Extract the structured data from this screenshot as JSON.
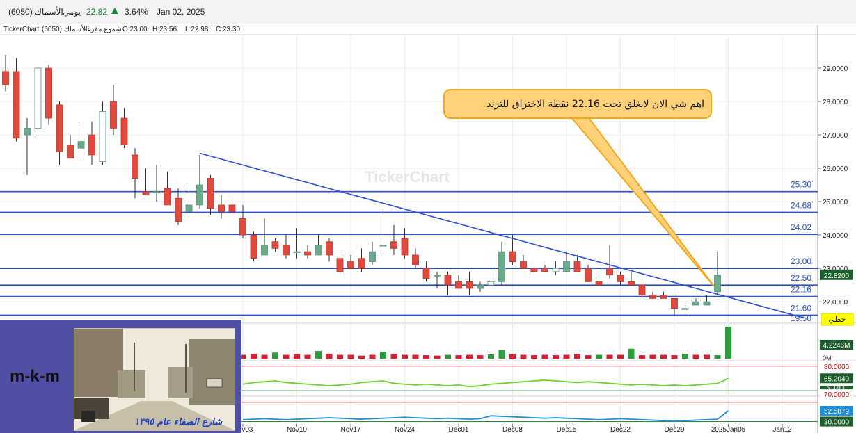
{
  "header": {
    "symbol": "الأسماك (6050)",
    "period": "يومي",
    "price": "22.82",
    "change_icon": "triangle-up-icon",
    "change_pct": "3.64%",
    "date": "Jan 02, 2025"
  },
  "ohlc_line": {
    "brand": "TickerChart",
    "symbol": "الأسماك (6050)",
    "chart_style": "شموع مفرغة",
    "open": "O:23.00",
    "high": "H:23.56",
    "low": "L:22.98",
    "close": "C:23.30"
  },
  "watermark": "TickerChart",
  "annotation_text": "اهم شي الان لايغلق تحت 22.16 نقطة الاختراق للترند",
  "line_type_label": "خطي",
  "colors": {
    "up": "#6aab8c",
    "down": "#e0493d",
    "hline": "#2b4fd6",
    "trend": "#2b4fd6",
    "callout_fill": "#ffd27a",
    "callout_border": "#f4a81f",
    "rsi": "#6fcf2c",
    "cci": "#1e8fd8",
    "panel_badge": "#1b5f2d"
  },
  "horizontal_levels": [
    {
      "value": 25.3,
      "label": "25.30"
    },
    {
      "value": 24.68,
      "label": "24.68"
    },
    {
      "value": 24.02,
      "label": "24.02"
    },
    {
      "value": 23.0,
      "label": "23.00"
    },
    {
      "value": 22.5,
      "label": "22.50"
    },
    {
      "value": 22.16,
      "label": "22.16"
    },
    {
      "value": 21.6,
      "label": "21.60"
    }
  ],
  "extra_label": {
    "value": 19.5,
    "label": "19.50"
  },
  "price_badge": "22.8200",
  "chart_data": {
    "type": "candlestick",
    "ylim": [
      21.4,
      30.0
    ],
    "y_ticks": [
      "22.0000",
      "23.0000",
      "24.0000",
      "25.0000",
      "26.0000",
      "27.0000",
      "28.0000",
      "29.0000"
    ],
    "y_tick_values": [
      22,
      23,
      24,
      25,
      26,
      27,
      28,
      29
    ],
    "x_labels": [
      "Nov03",
      "Nov10",
      "Nov17",
      "Nov24",
      "Dec01",
      "Dec08",
      "Dec15",
      "Dec22",
      "Dec29",
      "2025Jan05",
      "Jan12"
    ],
    "x_label_index": [
      22,
      27,
      32,
      37,
      42,
      47,
      52,
      57,
      62,
      67,
      72
    ],
    "candles": [
      {
        "o": 28.9,
        "h": 29.4,
        "l": 28.3,
        "c": 28.5
      },
      {
        "o": 28.9,
        "h": 29.3,
        "l": 26.8,
        "c": 26.9
      },
      {
        "o": 27.0,
        "h": 27.5,
        "l": 25.8,
        "c": 27.2
      },
      {
        "o": 27.2,
        "h": 29.0,
        "l": 26.9,
        "c": 29.0
      },
      {
        "o": 29.0,
        "h": 29.1,
        "l": 27.3,
        "c": 27.5
      },
      {
        "o": 27.9,
        "h": 28.0,
        "l": 26.1,
        "c": 26.5
      },
      {
        "o": 26.7,
        "h": 27.0,
        "l": 26.3,
        "c": 26.3
      },
      {
        "o": 26.6,
        "h": 27.3,
        "l": 26.3,
        "c": 26.8
      },
      {
        "o": 27.0,
        "h": 27.4,
        "l": 26.1,
        "c": 26.4
      },
      {
        "o": 26.2,
        "h": 28.0,
        "l": 26.1,
        "c": 27.7
      },
      {
        "o": 28.0,
        "h": 28.5,
        "l": 27.0,
        "c": 27.2
      },
      {
        "o": 27.5,
        "h": 27.8,
        "l": 26.6,
        "c": 26.7
      },
      {
        "o": 26.4,
        "h": 26.6,
        "l": 25.1,
        "c": 25.7
      },
      {
        "o": 25.3,
        "h": 26.0,
        "l": 25.2,
        "c": 25.2
      },
      {
        "o": 25.3,
        "h": 26.1,
        "l": 25.0,
        "c": 25.3
      },
      {
        "o": 25.4,
        "h": 25.9,
        "l": 25.0,
        "c": 24.9
      },
      {
        "o": 25.1,
        "h": 25.4,
        "l": 24.3,
        "c": 24.4
      },
      {
        "o": 24.7,
        "h": 25.5,
        "l": 24.6,
        "c": 24.9
      },
      {
        "o": 24.9,
        "h": 26.4,
        "l": 24.8,
        "c": 25.5
      },
      {
        "o": 25.7,
        "h": 25.8,
        "l": 24.6,
        "c": 24.8
      },
      {
        "o": 24.9,
        "h": 25.2,
        "l": 24.5,
        "c": 24.7
      },
      {
        "o": 24.9,
        "h": 25.2,
        "l": 24.7,
        "c": 24.7
      },
      {
        "o": 24.5,
        "h": 24.9,
        "l": 23.9,
        "c": 24.0
      },
      {
        "o": 24.0,
        "h": 24.1,
        "l": 23.2,
        "c": 23.3
      },
      {
        "o": 23.4,
        "h": 24.5,
        "l": 23.4,
        "c": 23.7
      },
      {
        "o": 23.8,
        "h": 23.9,
        "l": 23.5,
        "c": 23.6
      },
      {
        "o": 23.7,
        "h": 24.0,
        "l": 23.3,
        "c": 23.4
      },
      {
        "o": 23.5,
        "h": 24.2,
        "l": 23.3,
        "c": 23.5
      },
      {
        "o": 23.5,
        "h": 23.7,
        "l": 23.3,
        "c": 23.4
      },
      {
        "o": 23.4,
        "h": 24.0,
        "l": 23.4,
        "c": 23.7
      },
      {
        "o": 23.8,
        "h": 23.9,
        "l": 23.2,
        "c": 23.4
      },
      {
        "o": 23.3,
        "h": 23.5,
        "l": 22.8,
        "c": 22.9
      },
      {
        "o": 23.2,
        "h": 23.4,
        "l": 23.0,
        "c": 23.0
      },
      {
        "o": 23.3,
        "h": 23.6,
        "l": 22.9,
        "c": 23.0
      },
      {
        "o": 23.2,
        "h": 23.8,
        "l": 23.1,
        "c": 23.5
      },
      {
        "o": 23.7,
        "h": 24.8,
        "l": 23.5,
        "c": 23.7
      },
      {
        "o": 23.8,
        "h": 24.3,
        "l": 23.4,
        "c": 23.6
      },
      {
        "o": 23.9,
        "h": 24.2,
        "l": 23.3,
        "c": 23.4
      },
      {
        "o": 23.4,
        "h": 23.6,
        "l": 23.0,
        "c": 23.1
      },
      {
        "o": 23.0,
        "h": 23.2,
        "l": 22.6,
        "c": 22.7
      },
      {
        "o": 22.8,
        "h": 22.9,
        "l": 22.4,
        "c": 22.8
      },
      {
        "o": 22.8,
        "h": 22.9,
        "l": 22.2,
        "c": 22.5
      },
      {
        "o": 22.6,
        "h": 22.8,
        "l": 22.4,
        "c": 22.4
      },
      {
        "o": 22.6,
        "h": 22.9,
        "l": 22.2,
        "c": 22.4
      },
      {
        "o": 22.4,
        "h": 22.6,
        "l": 22.3,
        "c": 22.5
      },
      {
        "o": 22.5,
        "h": 22.9,
        "l": 22.5,
        "c": 22.6
      },
      {
        "o": 22.6,
        "h": 23.8,
        "l": 22.5,
        "c": 23.5
      },
      {
        "o": 23.5,
        "h": 24.0,
        "l": 23.1,
        "c": 23.2
      },
      {
        "o": 23.2,
        "h": 23.4,
        "l": 23.0,
        "c": 23.0
      },
      {
        "o": 23.0,
        "h": 23.2,
        "l": 22.8,
        "c": 22.9
      },
      {
        "o": 23.0,
        "h": 23.1,
        "l": 22.9,
        "c": 22.9
      },
      {
        "o": 22.9,
        "h": 23.2,
        "l": 22.8,
        "c": 23.0
      },
      {
        "o": 22.9,
        "h": 23.5,
        "l": 22.9,
        "c": 23.2
      },
      {
        "o": 23.2,
        "h": 23.4,
        "l": 22.9,
        "c": 22.9
      },
      {
        "o": 23.0,
        "h": 23.1,
        "l": 22.6,
        "c": 22.6
      },
      {
        "o": 22.6,
        "h": 22.8,
        "l": 22.5,
        "c": 22.5
      },
      {
        "o": 23.0,
        "h": 23.7,
        "l": 22.7,
        "c": 22.8
      },
      {
        "o": 22.8,
        "h": 22.9,
        "l": 22.5,
        "c": 22.6
      },
      {
        "o": 22.6,
        "h": 22.9,
        "l": 22.5,
        "c": 22.5
      },
      {
        "o": 22.5,
        "h": 22.6,
        "l": 22.1,
        "c": 22.2
      },
      {
        "o": 22.2,
        "h": 22.3,
        "l": 22.1,
        "c": 22.1
      },
      {
        "o": 22.2,
        "h": 22.3,
        "l": 22.1,
        "c": 22.1
      },
      {
        "o": 22.1,
        "h": 22.1,
        "l": 21.6,
        "c": 21.8
      },
      {
        "o": 21.8,
        "h": 21.9,
        "l": 21.6,
        "c": 21.8
      },
      {
        "o": 21.9,
        "h": 22.1,
        "l": 21.9,
        "c": 22.0
      },
      {
        "o": 21.9,
        "h": 22.2,
        "l": 21.9,
        "c": 22.0
      },
      {
        "o": 22.3,
        "h": 23.5,
        "l": 22.2,
        "c": 22.8
      }
    ],
    "trendline": {
      "from_index": 18,
      "from_value": 26.45,
      "to_index": 74,
      "to_value": 21.52
    },
    "volume": {
      "label": "4.2246M",
      "zero_label": "0M",
      "values": [
        0.55,
        0.7,
        1.1,
        0.55,
        0.5,
        0.9,
        0.6,
        0.5,
        0.8,
        0.6,
        0.5,
        0.7,
        0.5,
        0.45,
        0.45,
        0.5,
        0.45,
        0.5,
        1.6,
        0.45,
        0.6,
        0.55,
        0.5,
        0.6,
        0.5,
        0.8,
        0.5,
        0.6,
        0.5,
        1.0,
        0.6,
        0.5,
        0.5,
        0.4,
        0.5,
        0.9,
        0.6,
        0.5,
        0.5,
        0.45,
        0.4,
        0.5,
        0.45,
        0.5,
        0.45,
        0.55,
        1.1,
        0.6,
        0.5,
        0.45,
        0.5,
        0.45,
        0.5,
        0.6,
        0.45,
        0.5,
        0.5,
        0.5,
        1.3,
        0.45,
        0.5,
        0.5,
        0.45,
        0.6,
        0.5,
        0.5,
        0.45,
        4.2
      ],
      "up": [
        false,
        false,
        true,
        false,
        false,
        true,
        false,
        false,
        true,
        false,
        false,
        true,
        false,
        false,
        false,
        false,
        true,
        false,
        true,
        false,
        false,
        true,
        false,
        false,
        false,
        true,
        false,
        false,
        false,
        true,
        false,
        false,
        false,
        false,
        false,
        true,
        false,
        false,
        false,
        false,
        false,
        true,
        false,
        false,
        false,
        true,
        true,
        false,
        false,
        false,
        false,
        false,
        false,
        false,
        false,
        true,
        false,
        false,
        true,
        false,
        false,
        false,
        false,
        true,
        false,
        false,
        true,
        true
      ]
    },
    "rsi": {
      "labels": [
        "80.0000",
        "65.2040",
        "70.0000"
      ],
      "hidden_label": "50.0000",
      "upper": 80,
      "lower": 50,
      "mid": 70,
      "value": 65.2,
      "values": [
        53,
        50,
        51,
        53,
        52,
        54,
        55,
        56,
        54,
        55,
        56,
        53,
        52,
        53,
        52,
        53,
        54,
        55,
        57,
        58,
        58,
        59,
        58,
        60,
        61,
        62,
        60,
        59,
        58,
        57,
        56,
        57,
        58,
        60,
        61,
        62,
        59,
        58,
        57,
        58,
        57,
        56,
        57,
        55,
        56,
        58,
        59,
        60,
        61,
        62,
        63,
        62,
        61,
        60,
        61,
        60,
        59,
        58,
        57,
        58,
        57,
        56,
        57,
        56,
        57,
        58,
        59,
        65.2
      ]
    },
    "cci": {
      "labels": [
        "52.5879",
        "30.0000"
      ],
      "upper": 70,
      "lower": 30,
      "value": 52.59,
      "values": [
        34,
        33,
        34,
        35,
        34,
        35,
        36,
        35,
        34,
        35,
        36,
        35,
        34,
        35,
        34,
        35,
        34,
        35,
        36,
        37,
        36,
        35,
        34,
        35,
        36,
        35,
        34,
        35,
        36,
        37,
        38,
        37,
        36,
        35,
        36,
        37,
        38,
        39,
        38,
        37,
        36,
        37,
        36,
        35,
        36,
        42,
        41,
        40,
        39,
        38,
        37,
        38,
        37,
        36,
        35,
        34,
        35,
        36,
        35,
        34,
        33,
        32,
        31,
        32,
        33,
        34,
        35,
        52.59
      ]
    }
  },
  "photo": {
    "caption": "شارع الصفاء عام ١٣٩٥",
    "brand": "m-k-m"
  }
}
